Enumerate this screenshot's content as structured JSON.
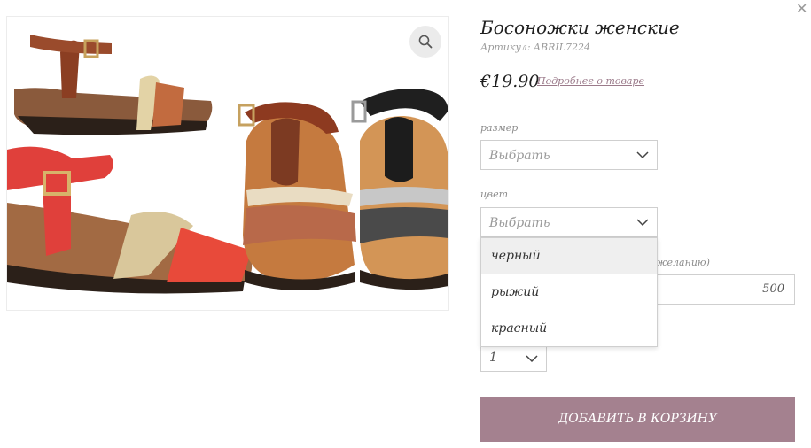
{
  "product": {
    "title": "Босоножки женские",
    "sku": "Артикул: ABRIL7224",
    "price": "€19.90",
    "more_link": "Подробнее о товаре"
  },
  "options": {
    "size": {
      "label": "размер",
      "selected": "Выбрать"
    },
    "color": {
      "label": "цвет",
      "selected": "Выбрать",
      "items": [
        "черный",
        "рыжий",
        "красный"
      ]
    },
    "partial_label": "желанию)",
    "partial_value": "500",
    "quantity": "1"
  },
  "cart": {
    "add_label": "ДОБАВИТЬ В КОРЗИНУ"
  },
  "colors": {
    "button": "#a4818f",
    "link": "#9b7a8a",
    "border": "#cfcfcf"
  },
  "icons": {
    "close": "close-icon",
    "zoom": "magnifier-icon",
    "chevron": "chevron-down-icon"
  }
}
